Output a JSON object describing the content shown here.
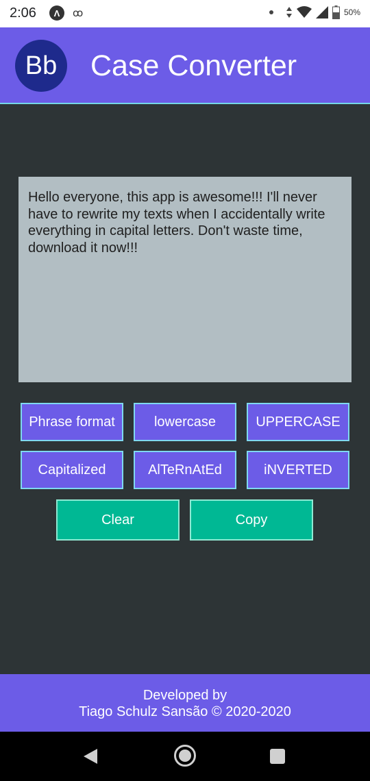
{
  "status_bar": {
    "time": "2:06",
    "battery": "50%",
    "icons": [
      "android-auto-icon",
      "voicemail-icon",
      "dot-icon",
      "data-arrows-icon",
      "wifi-icon",
      "signal-icon",
      "battery-icon"
    ]
  },
  "app_bar": {
    "logo_text": "Bb",
    "title": "Case Converter"
  },
  "editor": {
    "text": "Hello everyone, this app is awesome!!! I'll never have to rewrite my texts when I accidentally write everything in capital letters. Don't waste time, download it now!!!"
  },
  "buttons": {
    "phrase_format": "Phrase format",
    "lowercase": "lowercase",
    "uppercase": "UPPERCASE",
    "capitalized": "Capitalized",
    "alternated": "AlTeRnAtEd",
    "inverted": "iNVERTED",
    "clear": "Clear",
    "copy": "Copy"
  },
  "footer": {
    "line1": "Developed by",
    "line2": "Tiago Schulz Sansão © 2020-2020"
  },
  "colors": {
    "primary": "#6c5ce7",
    "accent": "#00b894",
    "background": "#2d3436",
    "text_area": "#b2bec3"
  }
}
